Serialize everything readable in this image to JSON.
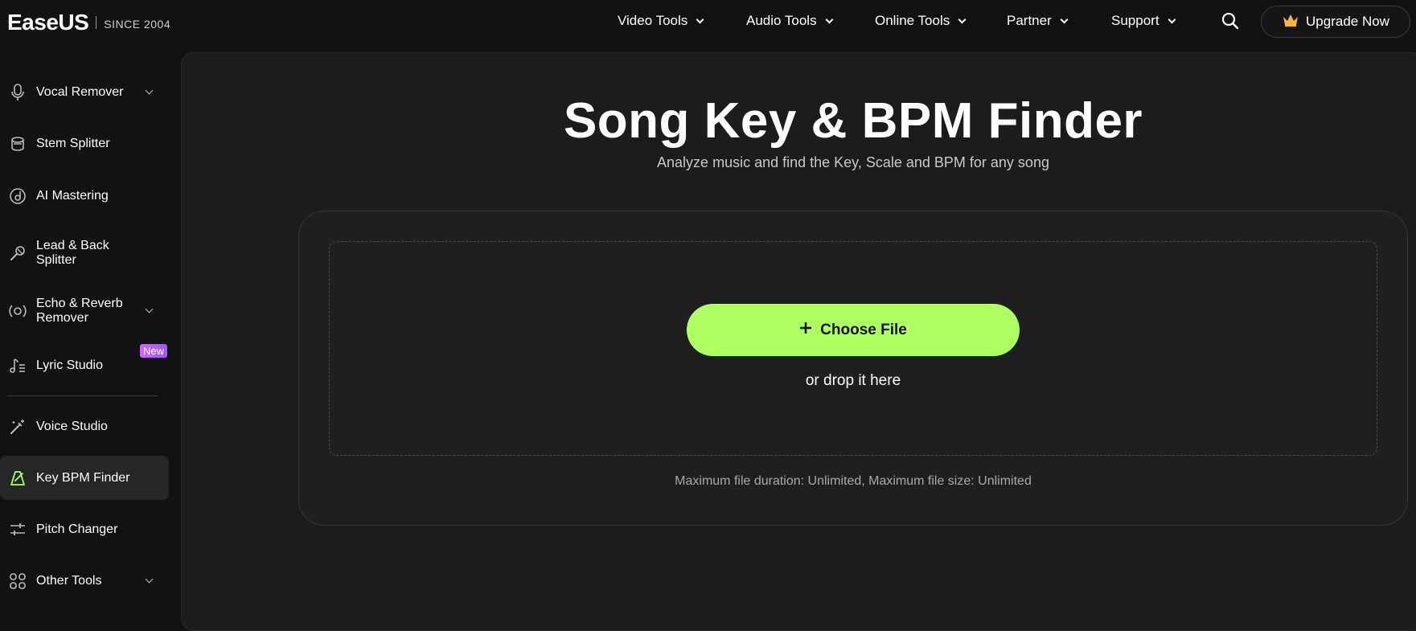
{
  "brand": {
    "logo_text": "EaseUS",
    "since": "SINCE 2004"
  },
  "nav": {
    "items": [
      {
        "label": "Video Tools"
      },
      {
        "label": "Audio Tools"
      },
      {
        "label": "Online Tools"
      },
      {
        "label": "Partner"
      },
      {
        "label": "Support"
      }
    ],
    "upgrade_label": "Upgrade Now"
  },
  "sidebar": {
    "items": [
      {
        "label": "Vocal Remover",
        "icon": "microphone-icon",
        "has_chevron": true
      },
      {
        "label": "Stem Splitter",
        "icon": "stem-splitter-icon"
      },
      {
        "label": "AI Mastering",
        "icon": "mastering-icon"
      },
      {
        "label": "Lead & Back Splitter",
        "icon": "mic-stand-icon"
      },
      {
        "label": "Echo & Reverb Remover",
        "icon": "reverb-icon",
        "has_chevron": true
      },
      {
        "label": "Lyric Studio",
        "icon": "lyric-icon",
        "badge": "New"
      },
      {
        "label": "Voice Studio",
        "icon": "magic-wand-icon"
      },
      {
        "label": "Key BPM Finder",
        "icon": "metronome-icon",
        "active": true
      },
      {
        "label": "Pitch Changer",
        "icon": "sliders-icon"
      },
      {
        "label": "Other Tools",
        "icon": "grid-icon",
        "has_chevron": true
      }
    ]
  },
  "main": {
    "title": "Song Key & BPM Finder",
    "subtitle": "Analyze music and find the Key, Scale and BPM for any song",
    "choose_file_label": "Choose File",
    "drop_text": "or drop it here",
    "limits_text": "Maximum file duration: Unlimited, Maximum file size: Unlimited"
  },
  "colors": {
    "accent": "#adff62",
    "background": "#121212",
    "panel": "#1c1c1c",
    "badge": "#b65cf6",
    "crown": "#f5b83d"
  }
}
